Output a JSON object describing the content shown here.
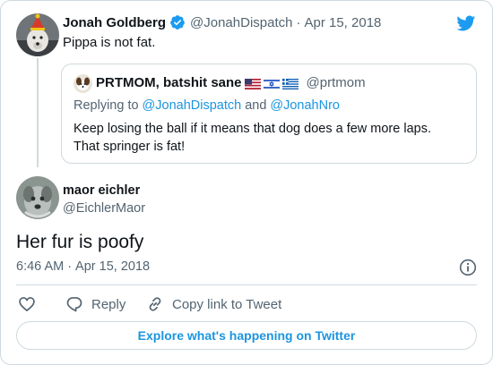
{
  "original_tweet": {
    "author_name": "Jonah Goldberg",
    "handle": "@JonahDispatch",
    "separator": "·",
    "date": "Apr 15, 2018",
    "text": "Pippa is not fat."
  },
  "quoted_tweet": {
    "author_name": "PRTMOM, batshit sane",
    "flags": [
      "us-flag",
      "israel-flag",
      "greece-flag"
    ],
    "handle": "@prtmom",
    "replying_prefix": "Replying to",
    "replying_user1": "@JonahDispatch",
    "replying_and": "and",
    "replying_user2": "@JonahNro",
    "text_line1": "Keep losing the ball if it means that dog does a few more laps.",
    "text_line2": "That springer is fat!"
  },
  "main_tweet": {
    "author_name": "maor eichler",
    "handle": "@EichlerMaor",
    "text": "Her fur is poofy",
    "time": "6:46 AM",
    "separator": "·",
    "date": "Apr 15, 2018"
  },
  "actions": {
    "reply_label": "Reply",
    "copy_link_label": "Copy link to Tweet"
  },
  "explore_label": "Explore what's happening on Twitter",
  "icons": {
    "brand": "twitter-bird-icon",
    "verified": "verified-badge-icon",
    "info": "info-icon",
    "like": "heart-icon",
    "reply": "reply-bubble-icon",
    "copy_link": "link-icon"
  },
  "colors": {
    "twitter_blue": "#1d9bf0",
    "link_blue": "#1b95e0",
    "muted": "#536471",
    "border": "#cfd9de"
  }
}
